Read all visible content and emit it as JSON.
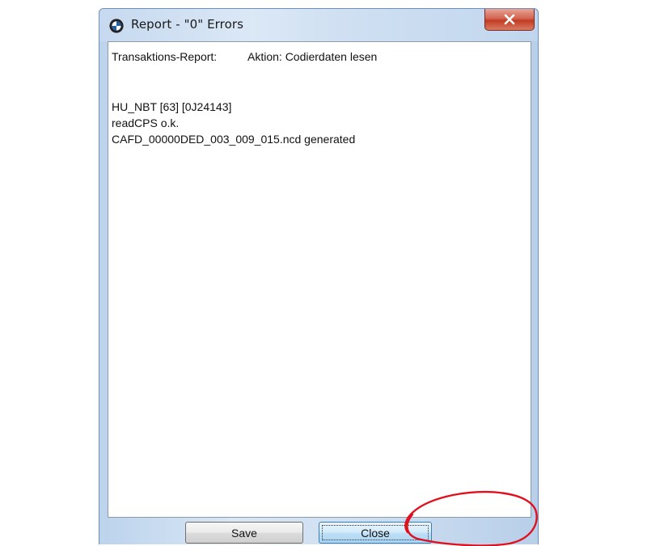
{
  "window": {
    "title": "Report - \"0\" Errors",
    "icon": "bmw-logo-icon",
    "close_glyph": "close-icon"
  },
  "report": {
    "header_label": "Transaktions-Report:",
    "header_action": "Aktion: Codierdaten lesen",
    "lines": [
      "HU_NBT [63] [0J24143]",
      "readCPS o.k.",
      "CAFD_00000DED_003_009_015.ncd generated"
    ]
  },
  "buttons": {
    "save": "Save",
    "close": "Close"
  },
  "colors": {
    "annotation": "#e0101e",
    "close_button_accent": "#3c7fb1",
    "title_close_red": "#c23b22"
  }
}
